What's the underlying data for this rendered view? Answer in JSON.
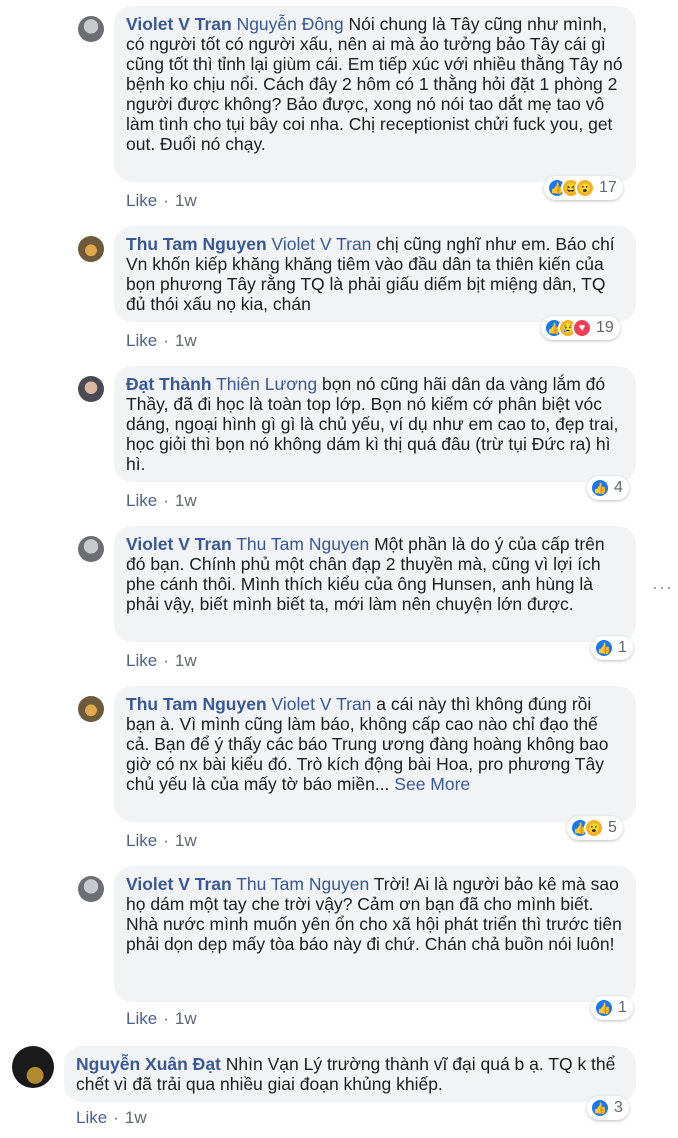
{
  "comments": [
    {
      "author": "Violet V Tran",
      "tag": "Nguyễn Đông",
      "text": "Nói chung là Tây cũng như mình, có người tốt có người xấu, nên ai mà ảo tưởng bảo Tây cái gì cũng tốt thì tỉnh lại giùm cái. Em tiếp xúc với nhiều thằng Tây nó bệnh ko chịu nổi. Cách đây 2 hôm có 1 thằng hỏi đặt 1 phòng 2 người được không? Bảo được, xong nó nói tao dắt mẹ tao vô làm tình cho tụi bây coi nha. Chị receptionist chửi fuck you, get out. Đuổi nó chạy.",
      "like_label": "Like",
      "time": "1w",
      "reactions": [
        "like-icon",
        "haha-icon",
        "wow-icon"
      ],
      "reaction_count": "17"
    },
    {
      "author": "Thu Tam Nguyen",
      "tag": "Violet V Tran",
      "text": "chị cũng nghĩ như em. Báo chí Vn khốn kiếp khăng khăng tiêm vào đầu dân ta thiên kiến của bọn phương Tây rằng TQ là phải giấu diếm bịt miệng dân, TQ đủ thói xấu nọ kia, chán",
      "like_label": "Like",
      "time": "1w",
      "reactions": [
        "like-icon",
        "sad-icon",
        "love-icon"
      ],
      "reaction_count": "19"
    },
    {
      "author": "Đạt Thành",
      "tag": "Thiên Lương",
      "text": "bọn nó cũng hãi dân da vàng lắm đó Thầy, đã đi học là toàn top lớp. Bọn nó kiếm cớ phân biệt vóc dáng, ngoại hình gì gì là chủ yếu, ví dụ như em cao to, đẹp trai, học giỏi thì bọn nó không dám kì thị quá đâu (trừ tụi Đức ra) hì hì.",
      "like_label": "Like",
      "time": "1w",
      "reactions": [
        "like-icon"
      ],
      "reaction_count": "4"
    },
    {
      "author": "Violet V Tran",
      "tag": "Thu Tam Nguyen",
      "text": "Một phần là do ý của cấp trên đó bạn. Chính phủ một chân đạp 2 thuyền mà, cũng vì lợi ích phe cánh thôi. Mình thích kiểu của ông Hunsen, anh hùng là phải vậy, biết mình biết ta, mới làm nên chuyện lớn được.",
      "like_label": "Like",
      "time": "1w",
      "reactions": [
        "like-icon"
      ],
      "reaction_count": "1"
    },
    {
      "author": "Thu Tam Nguyen",
      "tag": "Violet V Tran",
      "text": "a cái này thì không đúng rồi bạn à. Vì mình cũng làm báo, không cấp cao nào chỉ đạo thế cả. Bạn để ý thấy các báo Trung ương đàng hoàng không bao giờ có nx bài kiểu đó. Trò kích động bài Hoa, pro phương Tây chủ yếu là của mấy tờ báo miền...",
      "see_more": "See More",
      "like_label": "Like",
      "time": "1w",
      "reactions": [
        "like-icon",
        "wow-icon"
      ],
      "reaction_count": "5"
    },
    {
      "author": "Violet V Tran",
      "tag": "Thu Tam Nguyen",
      "text": "Trời! Ai là người bảo kê mà sao họ dám một tay che trời vậy? Cảm ơn bạn đã cho mình biết. Nhà nước mình muốn yên ổn cho xã hội phát triển thì trước tiên phải dọn dẹp mấy tòa báo này đi chứ. Chán chả buồn nói luôn!",
      "like_label": "Like",
      "time": "1w",
      "reactions": [
        "like-icon"
      ],
      "reaction_count": "1"
    },
    {
      "author": "Nguyễn Xuân Đạt",
      "text": "Nhìn Vạn Lý trường thành vĩ đại quá b ạ. TQ k thể chết vì đã trải qua nhiều giai đoạn khủng khiếp.",
      "like_label": "Like",
      "time": "1w",
      "reactions": [
        "like-icon"
      ],
      "reaction_count": "3"
    }
  ],
  "more_options": "···"
}
